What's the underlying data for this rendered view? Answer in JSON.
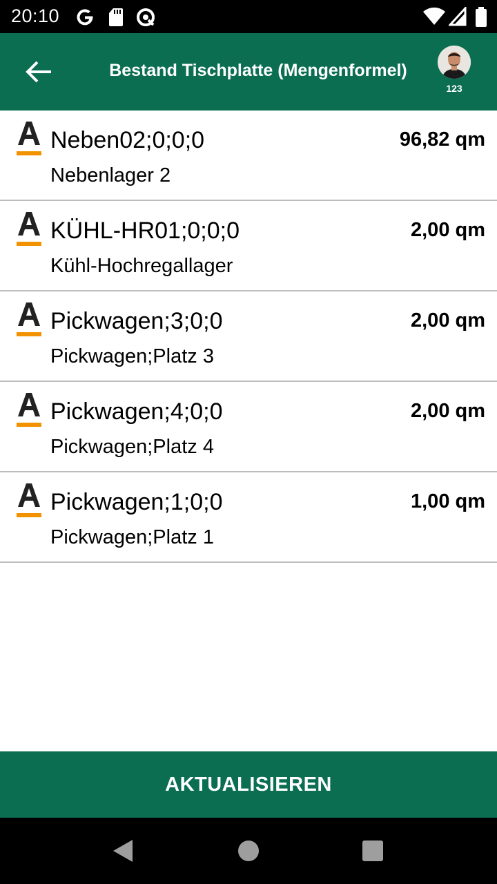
{
  "status_bar": {
    "time": "20:10",
    "left_icons": [
      "google-icon",
      "sd-card-icon",
      "data-saver-icon"
    ],
    "right_icons": [
      "wifi-icon",
      "signal-icon",
      "battery-icon"
    ]
  },
  "header": {
    "title": "Bestand Tischplatte (Mengenformel)",
    "user_id": "123",
    "back_icon": "arrow-left-icon"
  },
  "stock_rows": [
    {
      "location": "Neben02;0;0;0",
      "description": "Nebenlager 2",
      "quantity": "96,82 qm"
    },
    {
      "location": "KÜHL-HR01;0;0;0",
      "description": "Kühl-Hochregallager",
      "quantity": "2,00 qm"
    },
    {
      "location": "Pickwagen;3;0;0",
      "description": "Pickwagen;Platz 3",
      "quantity": "2,00 qm"
    },
    {
      "location": "Pickwagen;4;0;0",
      "description": "Pickwagen;Platz 4",
      "quantity": "2,00 qm"
    },
    {
      "location": "Pickwagen;1;0;0",
      "description": "Pickwagen;Platz 1",
      "quantity": "1,00 qm"
    }
  ],
  "refresh_button": {
    "label": "AKTUALISIEREN"
  },
  "colors": {
    "primary": "#0b6e51",
    "accent": "#f39200",
    "status_bar": "#000000",
    "divider": "#bdbdbd"
  }
}
